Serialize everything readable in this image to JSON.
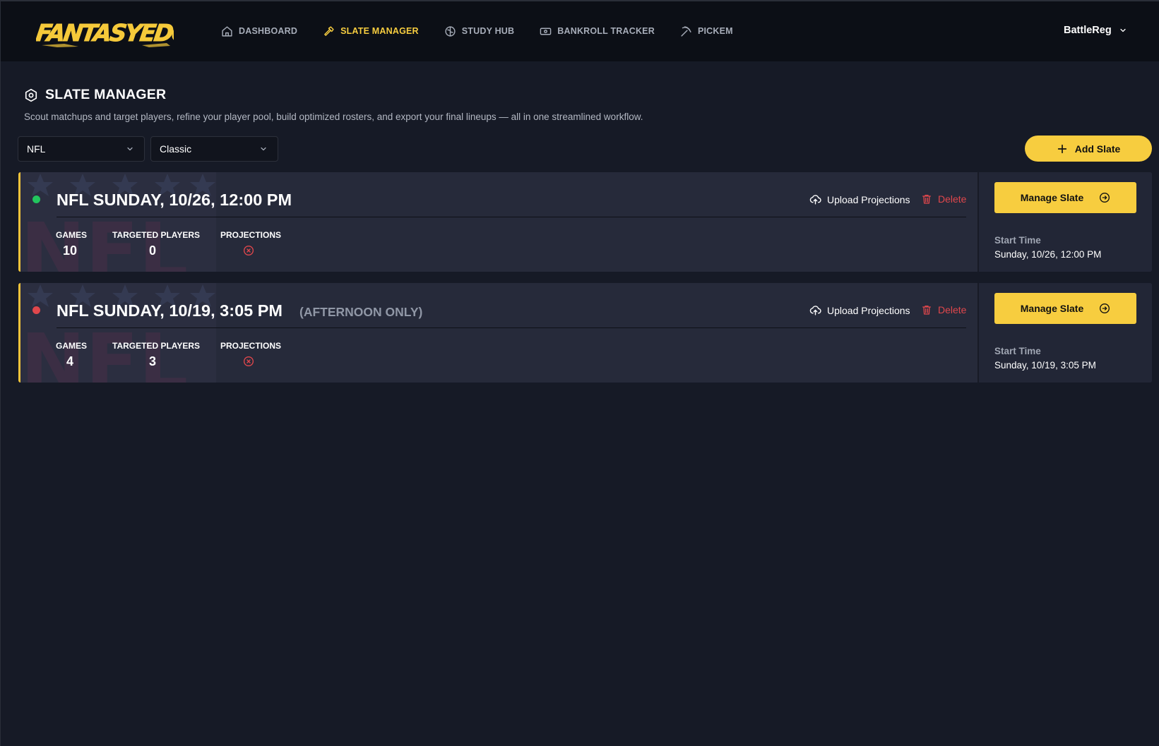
{
  "navbar": {
    "logo_text": "FANTASYEDGE",
    "items": [
      {
        "label": "DASHBOARD",
        "icon": "home-icon",
        "active": false
      },
      {
        "label": "SLATE MANAGER",
        "icon": "hammer-icon",
        "active": true
      },
      {
        "label": "STUDY HUB",
        "icon": "brain-icon",
        "active": false
      },
      {
        "label": "BANKROLL TRACKER",
        "icon": "banknote-icon",
        "active": false
      },
      {
        "label": "PICKEM",
        "icon": "pickaxe-icon",
        "active": false
      }
    ],
    "user": "BattleReg"
  },
  "header": {
    "title": "SLATE MANAGER",
    "description": "Scout matchups and target players, refine your player pool, build optimized rosters, and export your final lineups — all in one streamlined workflow."
  },
  "filters": {
    "sport": "NFL",
    "format": "Classic"
  },
  "add_slate_label": "Add Slate",
  "slates": [
    {
      "title": "NFL SUNDAY, 10/26, 12:00 PM",
      "subtitle": "",
      "status_color": "#22c55e",
      "upload_label": "Upload Projections",
      "delete_label": "Delete",
      "games_label": "GAMES",
      "games": "10",
      "targeted_label": "TARGETED PLAYERS",
      "targeted": "0",
      "projections_label": "PROJECTIONS",
      "manage_label": "Manage Slate",
      "start_label": "Start Time",
      "start_value": "Sunday, 10/26, 12:00 PM"
    },
    {
      "title": "NFL SUNDAY, 10/19, 3:05 PM",
      "subtitle": "(AFTERNOON ONLY)",
      "status_color": "#e0474c",
      "upload_label": "Upload Projections",
      "delete_label": "Delete",
      "games_label": "GAMES",
      "games": "4",
      "targeted_label": "TARGETED PLAYERS",
      "targeted": "3",
      "projections_label": "PROJECTIONS",
      "manage_label": "Manage Slate",
      "start_label": "Start Time",
      "start_value": "Sunday, 10/19, 3:05 PM"
    }
  ],
  "colors": {
    "accent": "#f7cd3f",
    "danger": "#e0474c",
    "background": "#161a26",
    "card": "#262a3a"
  }
}
